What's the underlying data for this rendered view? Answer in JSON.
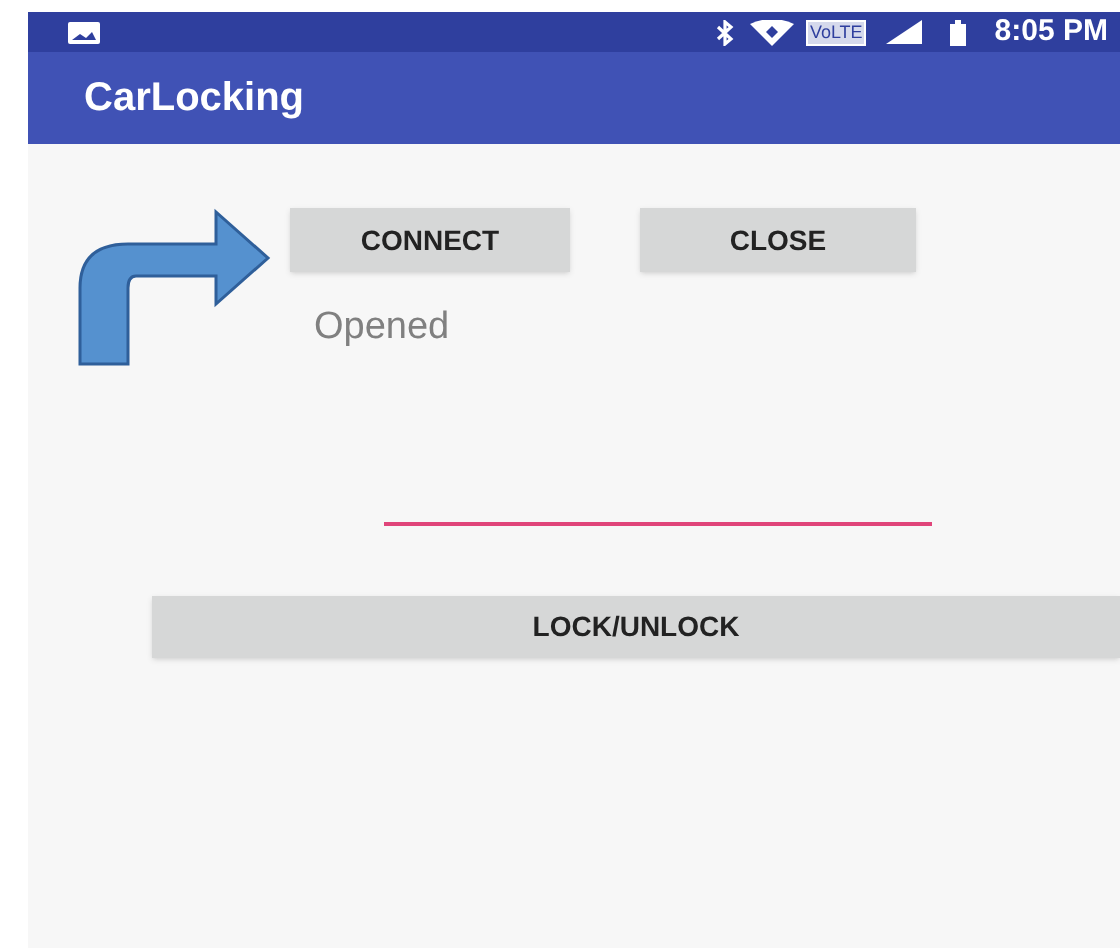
{
  "status_bar": {
    "time": "8:05 PM",
    "volte": "VoLTE"
  },
  "app_bar": {
    "title": "CarLocking"
  },
  "buttons": [
    {
      "label": "CONNECT"
    },
    {
      "label": "CLOSE"
    }
  ],
  "status_text": "Opened",
  "input_field": {
    "focused": true
  },
  "lock_button": {
    "label": "LOCK/UNLOCK"
  }
}
